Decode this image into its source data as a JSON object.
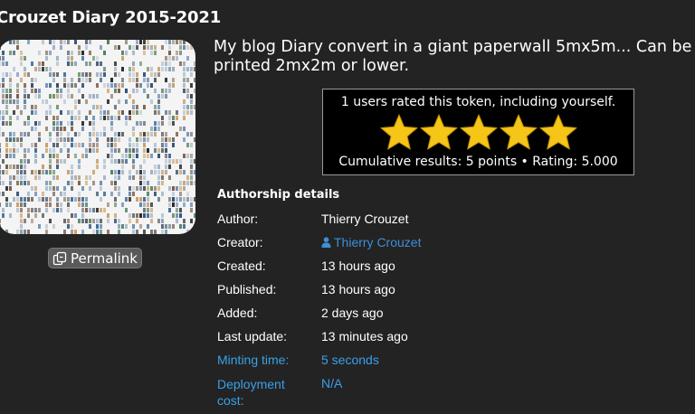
{
  "title": "Crouzet Diary 2015-2021",
  "description": {
    "line1": "My blog Diary convert in a giant paperwall 5mx5m... Can be",
    "line2": "printed 2mx2m or lower."
  },
  "permalink": {
    "label": "Permalink",
    "icon": "copy-link-icon"
  },
  "rating": {
    "users_text": "1 users rated this token, including yourself.",
    "stars": 5,
    "max_stars": 5,
    "results_text": "Cumulative results: 5 points • Rating: 5.000",
    "star_color": "#f5c518"
  },
  "authorship": {
    "heading": "Authorship details",
    "rows": [
      {
        "label": "Author:",
        "value": "Thierry Crouzet"
      },
      {
        "label": "Creator:",
        "value": "Thierry Crouzet",
        "icon": "person-icon"
      },
      {
        "label": "Created:",
        "value": "13 hours ago"
      },
      {
        "label": "Published:",
        "value": "13 hours ago"
      },
      {
        "label": "Added:",
        "value": "2 days ago"
      },
      {
        "label": "Last update:",
        "value": "13 minutes ago"
      },
      {
        "label": "Minting time:",
        "value": "5 seconds"
      },
      {
        "label": "Deployment cost:",
        "value": "N/A"
      }
    ]
  },
  "colors": {
    "background": "#232323",
    "link": "#3d8fd8",
    "highlight": "#3aa0e8"
  }
}
